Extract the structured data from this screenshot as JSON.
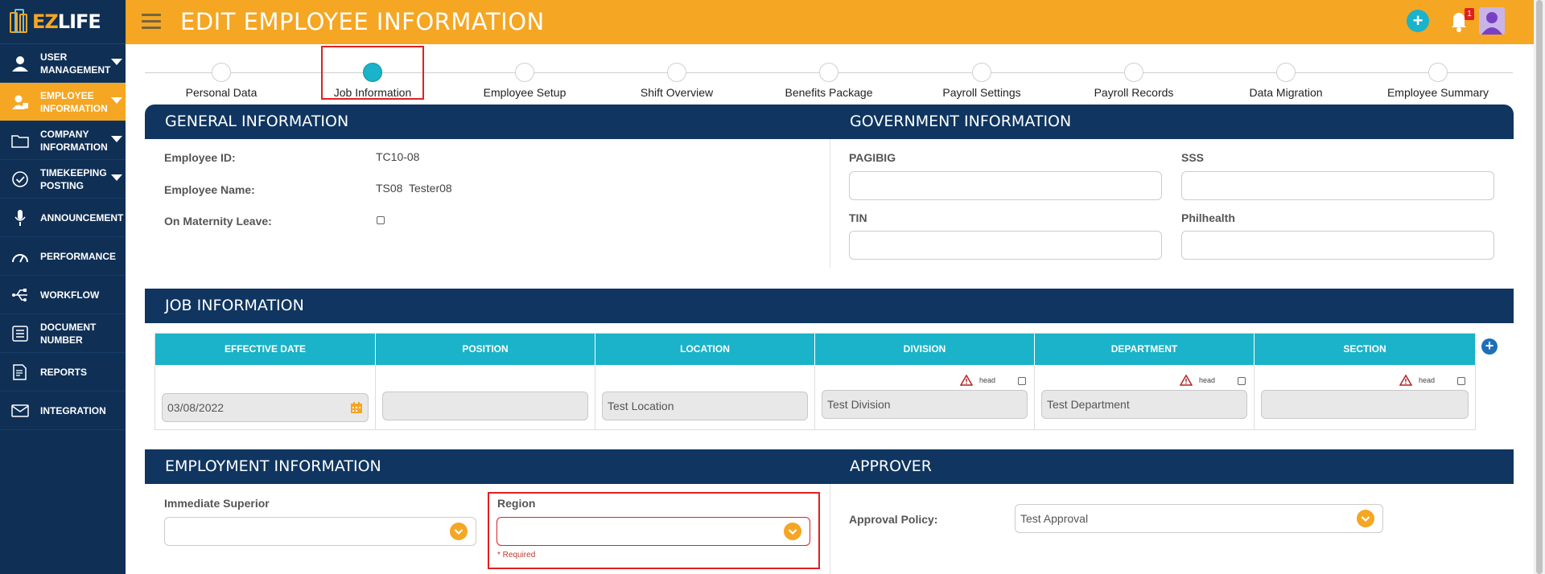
{
  "app": {
    "logo_text_ez": "EZ",
    "logo_text_life": "LIFE",
    "page_title": "EDIT EMPLOYEE INFORMATION",
    "notification_count": "1",
    "accent_color": "#f5a623",
    "nav_color": "#0f2f55",
    "teal_color": "#1ab3c9"
  },
  "sidebar": {
    "items": [
      {
        "label": "USER MANAGEMENT",
        "icon": "user-icon"
      },
      {
        "label": "EMPLOYEE INFORMATION",
        "icon": "employee-icon"
      },
      {
        "label": "COMPANY INFORMATION",
        "icon": "folder-icon"
      },
      {
        "label": "TIMEKEEPING POSTING",
        "icon": "check-circle-icon"
      },
      {
        "label": "ANNOUNCEMENT",
        "icon": "microphone-icon"
      },
      {
        "label": "PERFORMANCE",
        "icon": "gauge-icon"
      },
      {
        "label": "WORKFLOW",
        "icon": "usb-icon"
      },
      {
        "label": "DOCUMENT NUMBER",
        "icon": "list-icon"
      },
      {
        "label": "REPORTS",
        "icon": "report-icon"
      },
      {
        "label": "INTEGRATION",
        "icon": "envelope-icon"
      }
    ]
  },
  "steps": [
    {
      "label": "Personal Data"
    },
    {
      "label": "Job Information"
    },
    {
      "label": "Employee Setup"
    },
    {
      "label": "Shift Overview"
    },
    {
      "label": "Benefits Package"
    },
    {
      "label": "Payroll Settings"
    },
    {
      "label": "Payroll Records"
    },
    {
      "label": "Data Migration"
    },
    {
      "label": "Employee Summary"
    }
  ],
  "general": {
    "title": "GENERAL INFORMATION",
    "employee_id_label": "Employee ID:",
    "employee_id": "TC10-08",
    "employee_name_label": "Employee Name:",
    "employee_name": "TS08  Tester08",
    "maternity_label": "On Maternity Leave:"
  },
  "government": {
    "title": "GOVERNMENT INFORMATION",
    "pagibig_label": "PAGIBIG",
    "sss_label": "SSS",
    "tin_label": "TIN",
    "philhealth_label": "Philhealth"
  },
  "job": {
    "title": "JOB INFORMATION",
    "columns": [
      "EFFECTIVE DATE",
      "POSITION",
      "LOCATION",
      "DIVISION",
      "DEPARTMENT",
      "SECTION"
    ],
    "effective_date": "03/08/2022",
    "position": "",
    "location": "Test Location",
    "division": "Test Division",
    "department": "Test Department",
    "section": "",
    "head_label": "head"
  },
  "employment": {
    "title": "EMPLOYMENT INFORMATION",
    "immediate_superior_label": "Immediate Superior",
    "region_label": "Region",
    "required_text": "* Required"
  },
  "approver": {
    "title": "APPROVER",
    "policy_label": "Approval Policy:",
    "policy_value": "Test Approval"
  }
}
